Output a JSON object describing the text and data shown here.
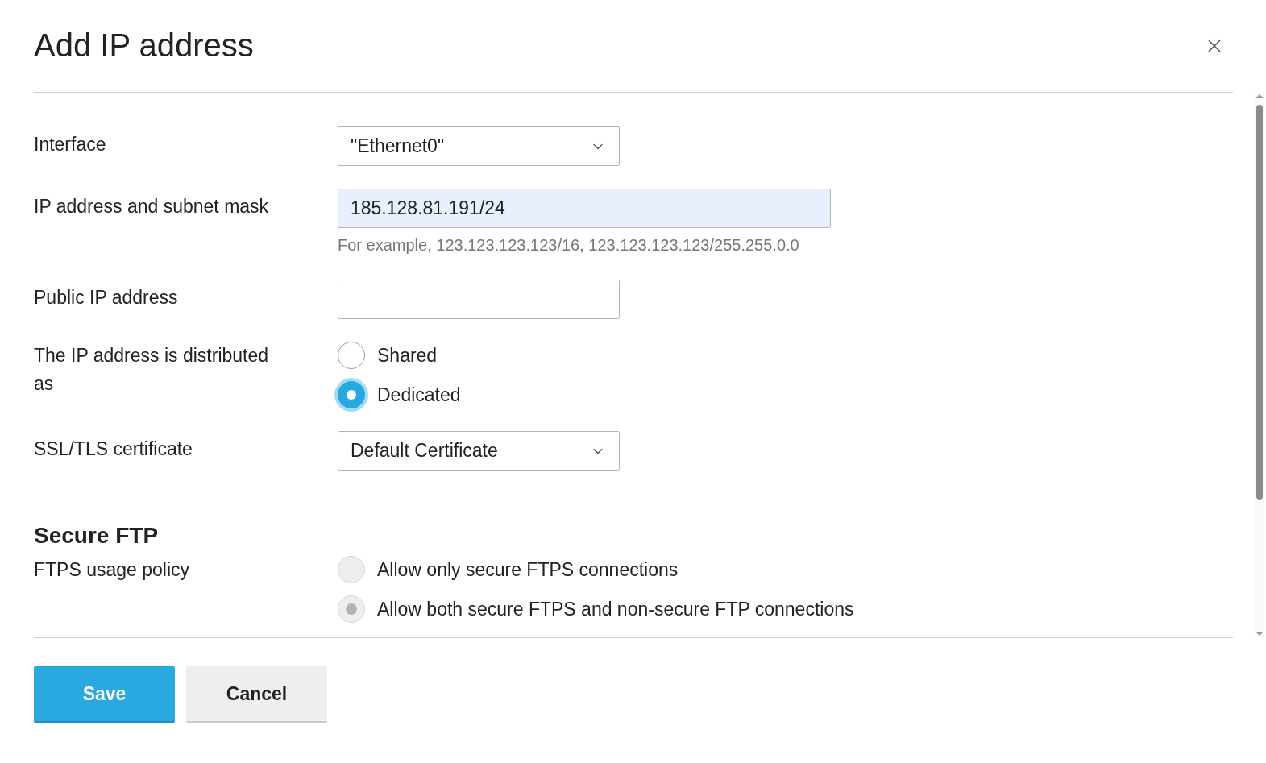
{
  "dialog": {
    "title": "Add IP address"
  },
  "fields": [
    {
      "kind": "select",
      "label": "Interface",
      "value": "\"Ethernet0\""
    },
    {
      "kind": "text",
      "label": "IP address and subnet mask",
      "value": "185.128.81.191/24",
      "autofilled": true,
      "hint": "For example, 123.123.123.123/16, 123.123.123.123/255.255.0.0"
    },
    {
      "kind": "text",
      "label": "Public IP address",
      "autofilled": false
    },
    {
      "kind": "radio",
      "label": "The IP address is distributed as",
      "disabled": false,
      "options": [
        {
          "label": "Shared",
          "selected": false
        },
        {
          "label": "Dedicated",
          "selected": true
        }
      ]
    },
    {
      "kind": "select",
      "label": "SSL/TLS certificate",
      "value": "Default Certificate"
    }
  ],
  "secure_ftp": {
    "heading": "Secure FTP",
    "fields": [
      {
        "kind": "radio",
        "label": "FTPS usage policy",
        "disabled": true,
        "options": [
          {
            "label": "Allow only secure FTPS connections",
            "selected": false
          },
          {
            "label": "Allow both secure FTPS and non-secure FTP connections",
            "selected": true
          }
        ]
      }
    ]
  },
  "buttons": [
    {
      "kind": "primary",
      "label": "Save"
    },
    {
      "kind": "secondary",
      "label": "Cancel"
    }
  ]
}
